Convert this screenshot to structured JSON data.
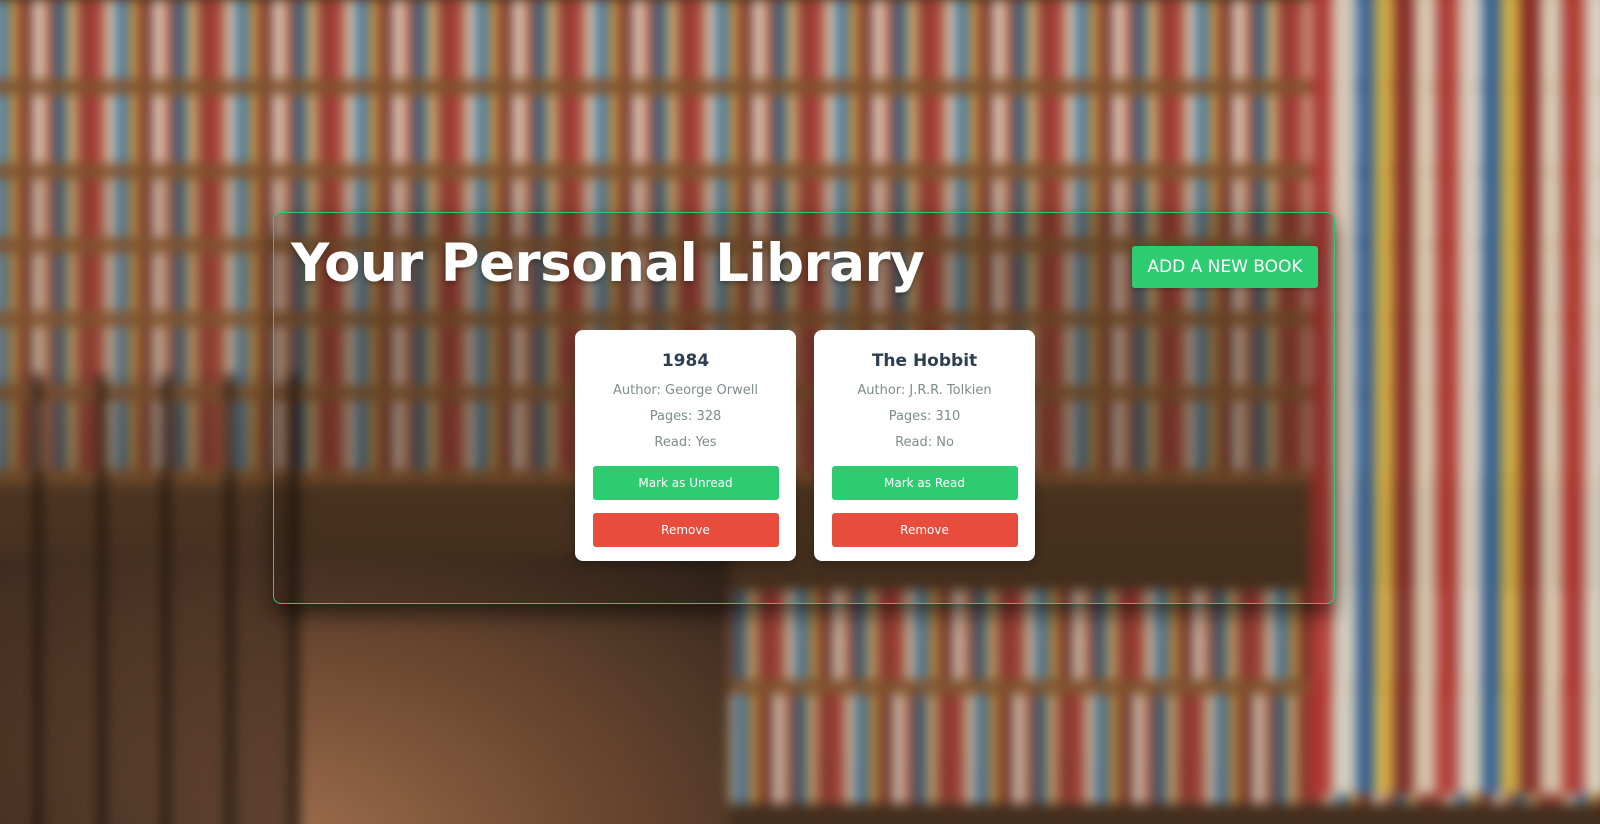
{
  "page": {
    "title": "Your Personal Library",
    "add_button_label": "ADD A NEW BOOK"
  },
  "books": [
    {
      "title": "1984",
      "author": "Author: George Orwell",
      "pages": "Pages: 328",
      "read": "Read: Yes",
      "toggle_label": "Mark as Unread",
      "remove_label": "Remove"
    },
    {
      "title": "The Hobbit",
      "author": "Author: J.R.R. Tolkien",
      "pages": "Pages: 310",
      "read": "Read: No",
      "toggle_label": "Mark as Read",
      "remove_label": "Remove"
    }
  ],
  "colors": {
    "accent_green": "#2ecc71",
    "danger_red": "#e74c3c",
    "title_text": "#2c3e50",
    "muted_text": "#7f8c8d"
  }
}
